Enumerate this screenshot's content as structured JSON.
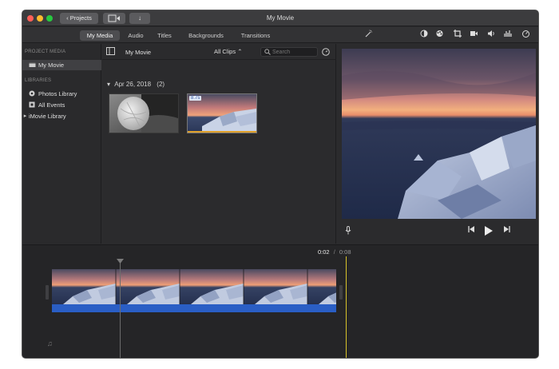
{
  "window": {
    "title": "My Movie",
    "projects_button": "Projects"
  },
  "toolbar": {
    "tabs": [
      {
        "label": "My Media",
        "active": true
      },
      {
        "label": "Audio",
        "active": false
      },
      {
        "label": "Titles",
        "active": false
      },
      {
        "label": "Backgrounds",
        "active": false
      },
      {
        "label": "Transitions",
        "active": false
      }
    ],
    "viewer_tools": [
      "magic-wand-icon",
      "color-balance-icon",
      "color-correction-icon",
      "crop-icon",
      "stabilization-icon",
      "volume-icon",
      "noise-reduction-icon",
      "speed-icon"
    ]
  },
  "sidebar": {
    "project_media_header": "PROJECT MEDIA",
    "project_item": "My Movie",
    "libraries_header": "LIBRARIES",
    "library_items": [
      {
        "label": "Photos Library",
        "icon": "photos-icon"
      },
      {
        "label": "All Events",
        "icon": "events-icon"
      }
    ],
    "imovie_library": "iMovie Library"
  },
  "browser": {
    "title": "My Movie",
    "filter_value": "All Clips",
    "search_placeholder": "Search",
    "date_group": "Apr 26, 2018",
    "group_count": "(2)",
    "clip2_badge": "8.7s"
  },
  "timeline": {
    "current_time": "0:02",
    "separator": "/",
    "total_time": "0:08"
  },
  "colors": {
    "accent_blue": "#2a5ec5",
    "skimmer_yellow": "#d9c32a",
    "selection_orange": "#e0a12b"
  }
}
